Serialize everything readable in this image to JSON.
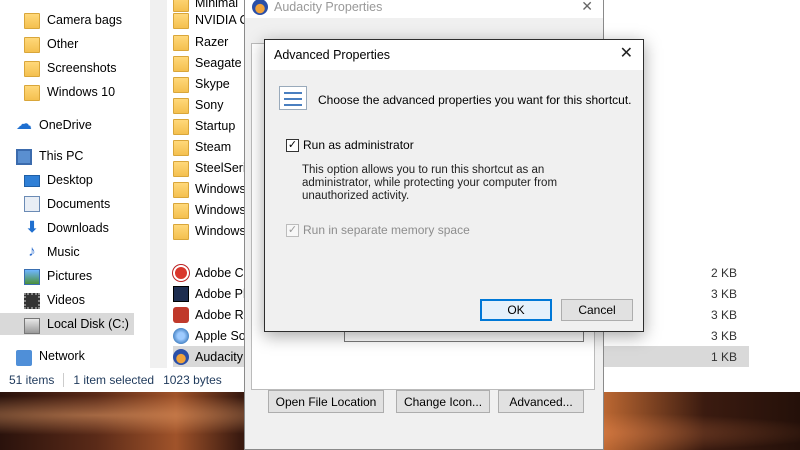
{
  "explorer": {
    "nav_items": [
      {
        "label": "Camera bags",
        "icon": "folder-icon"
      },
      {
        "label": "Other",
        "icon": "folder-icon"
      },
      {
        "label": "Screenshots",
        "icon": "folder-icon"
      },
      {
        "label": "Windows 10",
        "icon": "folder-icon"
      },
      {
        "label": "OneDrive",
        "icon": "onedrive-icon"
      },
      {
        "label": "This PC",
        "icon": "pc-icon"
      },
      {
        "label": "Desktop",
        "icon": "desktop-icon"
      },
      {
        "label": "Documents",
        "icon": "documents-icon"
      },
      {
        "label": "Downloads",
        "icon": "downloads-icon"
      },
      {
        "label": "Music",
        "icon": "music-icon"
      },
      {
        "label": "Pictures",
        "icon": "pictures-icon"
      },
      {
        "label": "Videos",
        "icon": "videos-icon"
      },
      {
        "label": "Local Disk (C:)",
        "icon": "drive-icon"
      },
      {
        "label": "Network",
        "icon": "network-icon"
      }
    ],
    "files": [
      {
        "name": "Minimal",
        "size": ""
      },
      {
        "name": "NVIDIA C",
        "size": ""
      },
      {
        "name": "Razer",
        "size": ""
      },
      {
        "name": "Seagate D",
        "size": ""
      },
      {
        "name": "Skype",
        "size": ""
      },
      {
        "name": "Sony",
        "size": ""
      },
      {
        "name": "Startup",
        "size": ""
      },
      {
        "name": "Steam",
        "size": ""
      },
      {
        "name": "SteelSerie",
        "size": ""
      },
      {
        "name": "Windows",
        "size": ""
      },
      {
        "name": "Windows",
        "size": ""
      },
      {
        "name": "Windows",
        "size": ""
      },
      {
        "name": "Adobe Cr",
        "size": "2 KB"
      },
      {
        "name": "Adobe Ph",
        "size": "3 KB"
      },
      {
        "name": "Adobe Re",
        "size": "3 KB"
      },
      {
        "name": "Apple Sof",
        "size": "3 KB"
      },
      {
        "name": "Audacity",
        "size": "1 KB"
      }
    ],
    "status": {
      "item_count": "51 items",
      "selection": "1 item selected",
      "selection_size": "1023 bytes"
    }
  },
  "properties": {
    "title": "Audacity Properties",
    "buttons": {
      "open_location": "Open File Location",
      "change_icon": "Change Icon...",
      "advanced": "Advanced..."
    }
  },
  "advanced": {
    "title": "Advanced Properties",
    "description": "Choose the advanced properties you want for this shortcut.",
    "run_as_admin": {
      "label": "Run as administrator",
      "checked": true
    },
    "info": "This option allows you to run this shortcut as an administrator, while protecting your computer from unauthorized activity.",
    "separate_memory": {
      "label": "Run in separate memory space",
      "checked": true,
      "enabled": false
    },
    "ok": "OK",
    "cancel": "Cancel"
  }
}
